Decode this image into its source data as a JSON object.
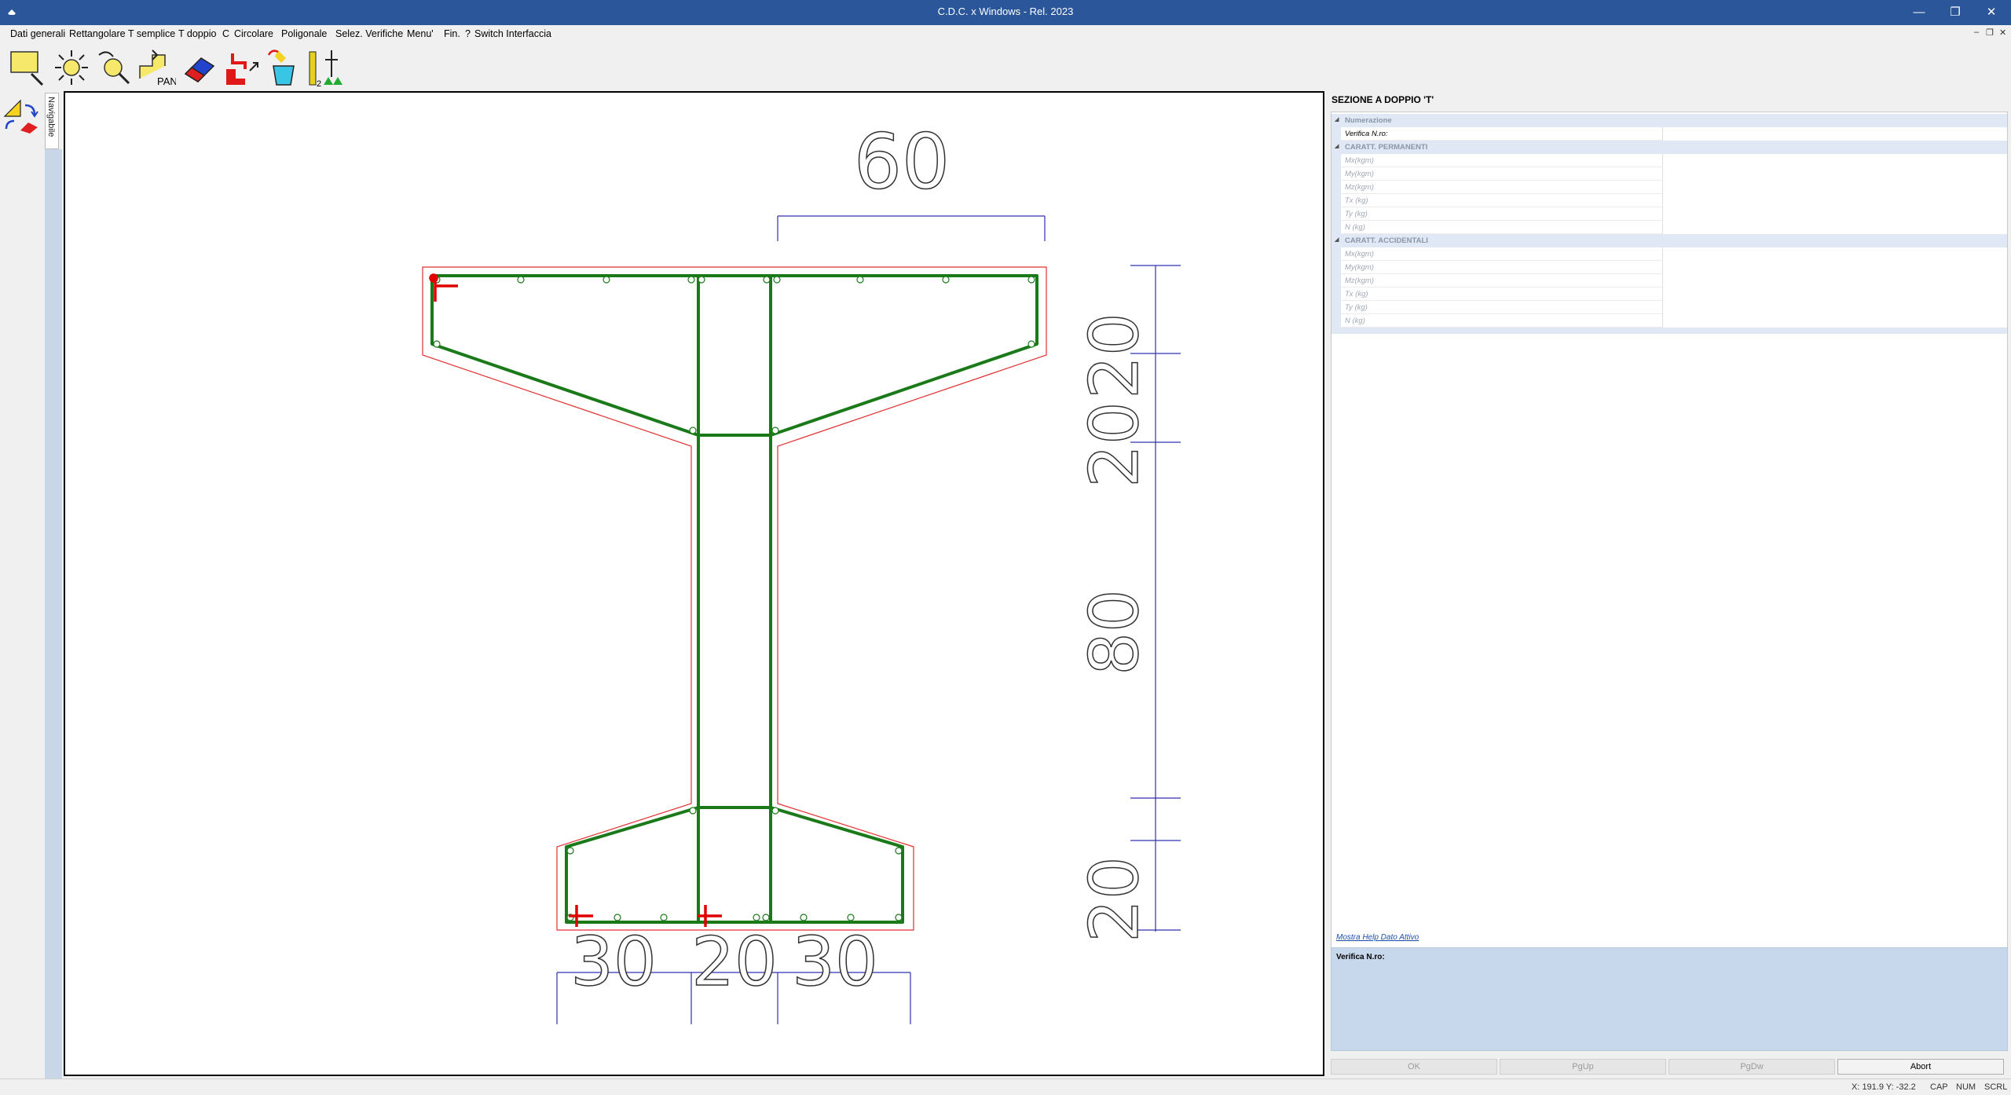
{
  "window": {
    "title": "C.D.C. x Windows - Rel. 2023",
    "controls": {
      "minimize": "—",
      "restore": "❐",
      "close": "✕"
    }
  },
  "menu": {
    "items": [
      "Dati generali",
      "Rettangolare",
      "T semplice",
      "T doppio",
      "C",
      "Circolare",
      "Poligonale",
      "Selez. Verifiche",
      "Menu'",
      "Fin.",
      "?",
      "Switch Interfaccia"
    ],
    "mdi_controls": {
      "minimize": "–",
      "restore": "❐",
      "close": "✕"
    }
  },
  "toolbar": {
    "tools": [
      "zoom-window-icon",
      "zoom-extents-icon",
      "zoom-previous-icon",
      "pan-icon",
      "eraser-icon",
      "corner-arrow-icon",
      "paint-bucket-icon",
      "axes-icon"
    ],
    "pan_label": "PAN",
    "axes_label": "2",
    "axes_glyphs": "▲"
  },
  "navigator": {
    "tab_label": "Navigabile",
    "tools": [
      "measure-icon",
      "rotate-icon"
    ]
  },
  "drawing": {
    "dimensions": {
      "top_width": "60",
      "right_stack": [
        "20",
        "20",
        "80",
        "20"
      ],
      "bottom_stack": [
        "30",
        "20",
        "30"
      ]
    },
    "colors": {
      "concrete_outline": "#e03030",
      "rebar": "#1a7a1a",
      "dimension": "#3030b0",
      "marker": "#e00000"
    }
  },
  "panel": {
    "title": "SEZIONE A DOPPIO 'T'",
    "categories": [
      {
        "label": "Numerazione",
        "rows": [
          {
            "label": "Verifica N.ro:",
            "active": true
          }
        ]
      },
      {
        "label": "CARATT. PERMANENTI",
        "rows": [
          {
            "label": "Mx(kgm)"
          },
          {
            "label": "My(kgm)"
          },
          {
            "label": "Mz(kgm)"
          },
          {
            "label": "Tx (kg)"
          },
          {
            "label": "Ty (kg)"
          },
          {
            "label": "N (kg)"
          }
        ]
      },
      {
        "label": "CARATT. ACCIDENTALI",
        "rows": [
          {
            "label": "Mx(kgm)"
          },
          {
            "label": "My(kgm)"
          },
          {
            "label": "Mz(kgm)"
          },
          {
            "label": "Tx (kg)"
          },
          {
            "label": "Ty (kg)"
          },
          {
            "label": "N (kg)"
          }
        ]
      }
    ],
    "help_link": "Mostra Help Dato Attivo",
    "help_text": "Verifica N.ro:",
    "buttons": {
      "ok": "OK",
      "pgup": "PgUp",
      "pgdw": "PgDw",
      "abort": "Abort"
    }
  },
  "status": {
    "coords": "X: 191.9  Y: -32.2",
    "cap": "CAP",
    "num": "NUM",
    "scrl": "SCRL"
  }
}
